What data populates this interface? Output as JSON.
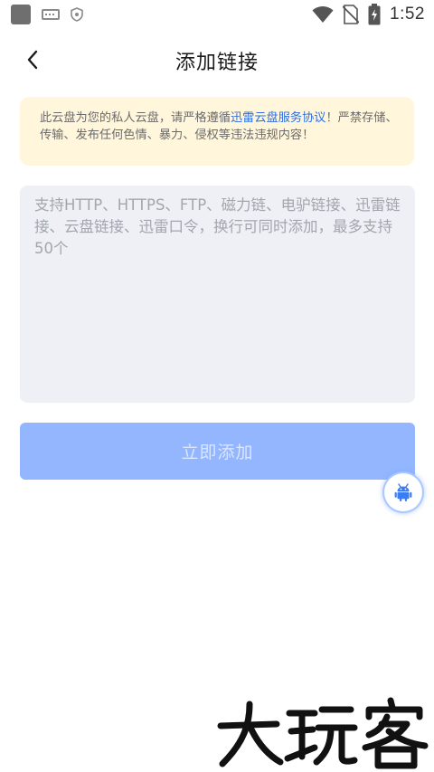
{
  "status_bar": {
    "time": "1:52",
    "icons": [
      "app-square-icon",
      "keyboard-icon",
      "shield-icon",
      "wifi-icon",
      "no-sim-icon",
      "battery-icon"
    ]
  },
  "header": {
    "back_icon": "chevron-left-icon",
    "title": "添加链接"
  },
  "notice": {
    "text_before": "此云盘为您的私人云盘，请严格遵循",
    "link_text": "迅雷云盘服务协议",
    "text_after": "！严禁存储、传输、发布任何色情、暴力、侵权等违法违规内容！"
  },
  "link_input": {
    "value": "",
    "placeholder": "支持HTTP、HTTPS、FTP、磁力链、电驴链接、迅雷链接、云盘链接、迅雷口令，换行可同时添加，最多支持50个"
  },
  "submit_button": {
    "label": "立即添加"
  },
  "float_button": {
    "icon": "android-icon"
  },
  "watermark": {
    "text": "大玩客"
  },
  "colors": {
    "accent": "#2f6fe0",
    "button_disabled": "#93b6ff",
    "notice_bg": "#fff6dc",
    "input_bg": "#eef0f5"
  }
}
